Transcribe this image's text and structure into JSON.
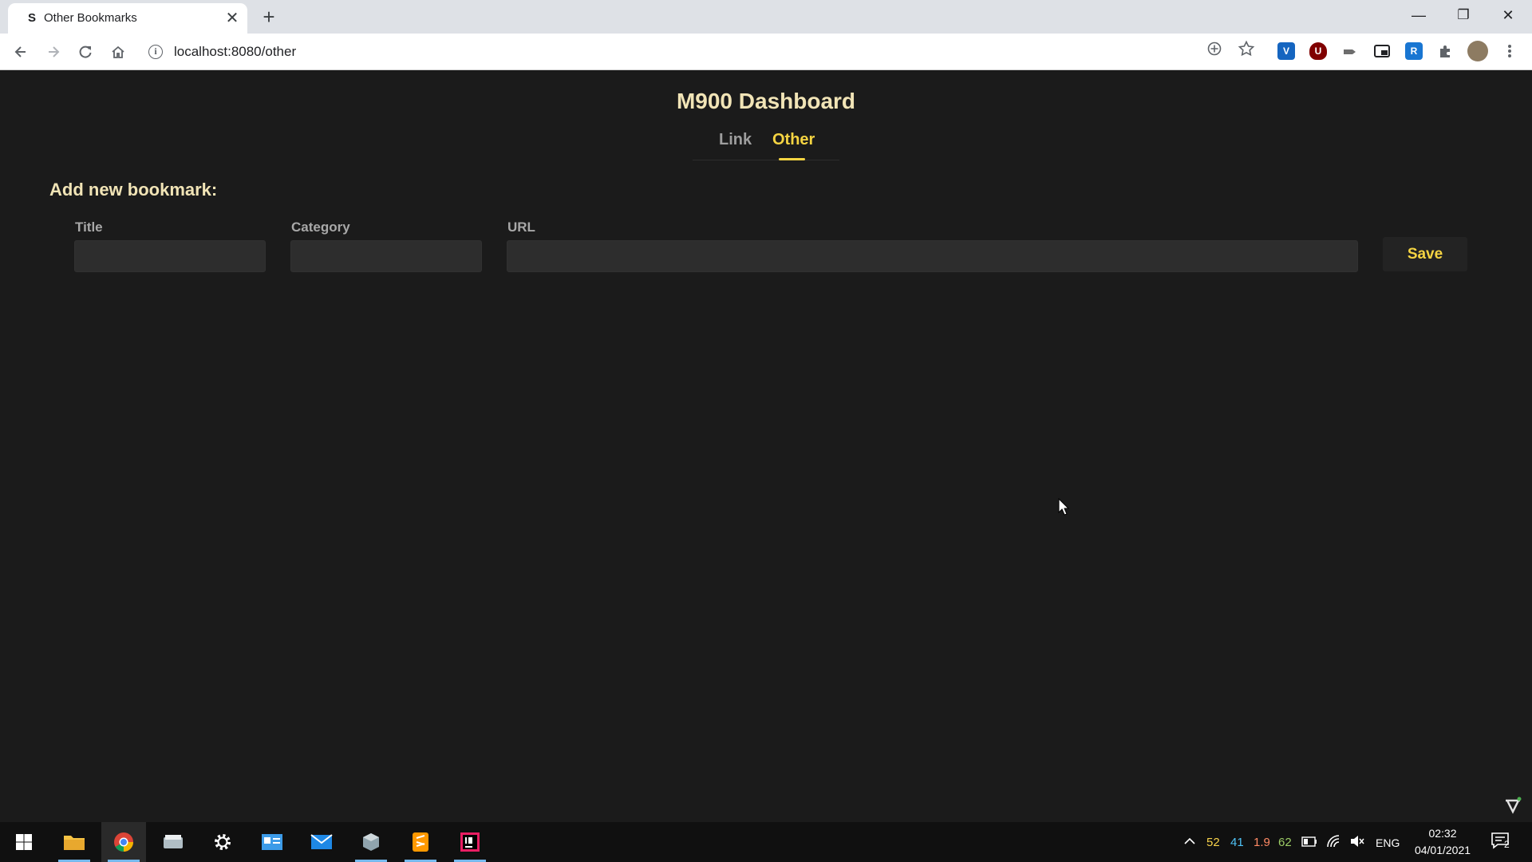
{
  "browser": {
    "tab_favicon": "S",
    "tab_title": "Other Bookmarks",
    "tab_close": "✕",
    "new_tab": "+",
    "url": "localhost:8080/other",
    "window_minimize": "—",
    "window_restore": "❐",
    "window_close": "✕",
    "extensions": [
      "V",
      "U",
      "R"
    ]
  },
  "page": {
    "title": "M900 Dashboard",
    "nav": {
      "link": "Link",
      "other": "Other"
    },
    "form": {
      "heading": "Add new bookmark:",
      "title_label": "Title",
      "category_label": "Category",
      "url_label": "URL",
      "title_value": "",
      "category_value": "",
      "url_value": "",
      "save_label": "Save"
    }
  },
  "taskbar": {
    "tray_numbers": [
      "52",
      "41",
      "1.9",
      "62"
    ],
    "tray_colors": [
      "#f7d24a",
      "#4fc3f7",
      "#ff8a65",
      "#9ccc65"
    ],
    "language": "ENG",
    "time": "02:32",
    "date": "04/01/2021",
    "notification_count": "2"
  },
  "colors": {
    "accent": "#f5d442",
    "title": "#f1e4b6",
    "background": "#1b1b1b"
  }
}
